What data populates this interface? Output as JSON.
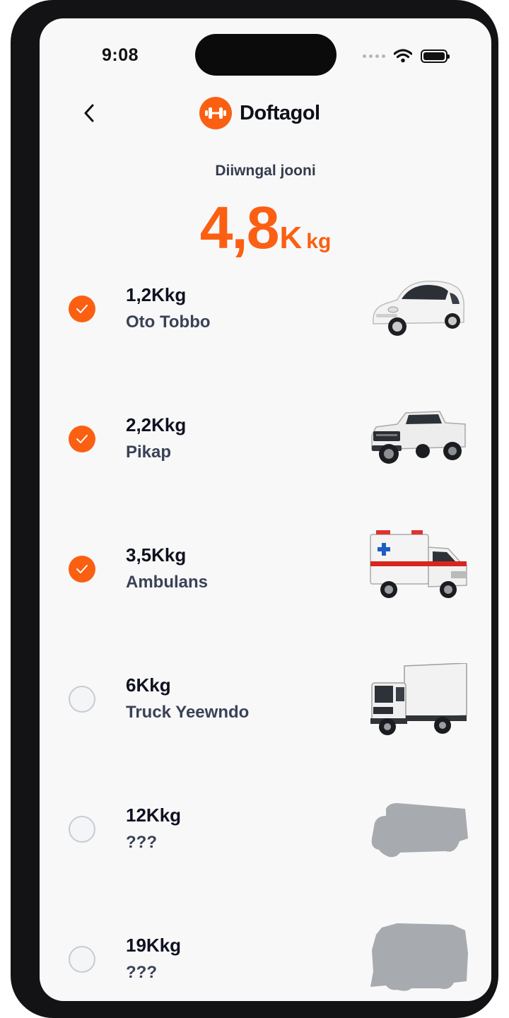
{
  "status_bar": {
    "time": "9:08"
  },
  "header": {
    "brand_name": "Doftagol",
    "icons": {
      "back": "chevron-left-icon",
      "logo": "dumbbell-icon"
    }
  },
  "summary": {
    "label": "Diiwngal jooni",
    "value": "4,8",
    "unit_k": "K",
    "unit_kg": "kg"
  },
  "colors": {
    "accent": "#fb5f12",
    "text_dark": "#0f1120",
    "text_muted": "#3a4257",
    "silhouette": "#a7aaaf"
  },
  "vehicles": [
    {
      "weight": "1,2Kkg",
      "name": "Oto Tobbo",
      "checked": true,
      "image": "small-car"
    },
    {
      "weight": "2,2Kkg",
      "name": "Pikap",
      "checked": true,
      "image": "pickup-truck"
    },
    {
      "weight": "3,5Kkg",
      "name": "Ambulans",
      "checked": true,
      "image": "ambulance"
    },
    {
      "weight": "6Kkg",
      "name": "Truck Yeewndo",
      "checked": false,
      "image": "box-truck"
    },
    {
      "weight": "12Kkg",
      "name": "???",
      "checked": false,
      "image": "locked-truck-silhouette"
    },
    {
      "weight": "19Kkg",
      "name": "???",
      "checked": false,
      "image": "locked-heavy-truck-silhouette"
    }
  ]
}
